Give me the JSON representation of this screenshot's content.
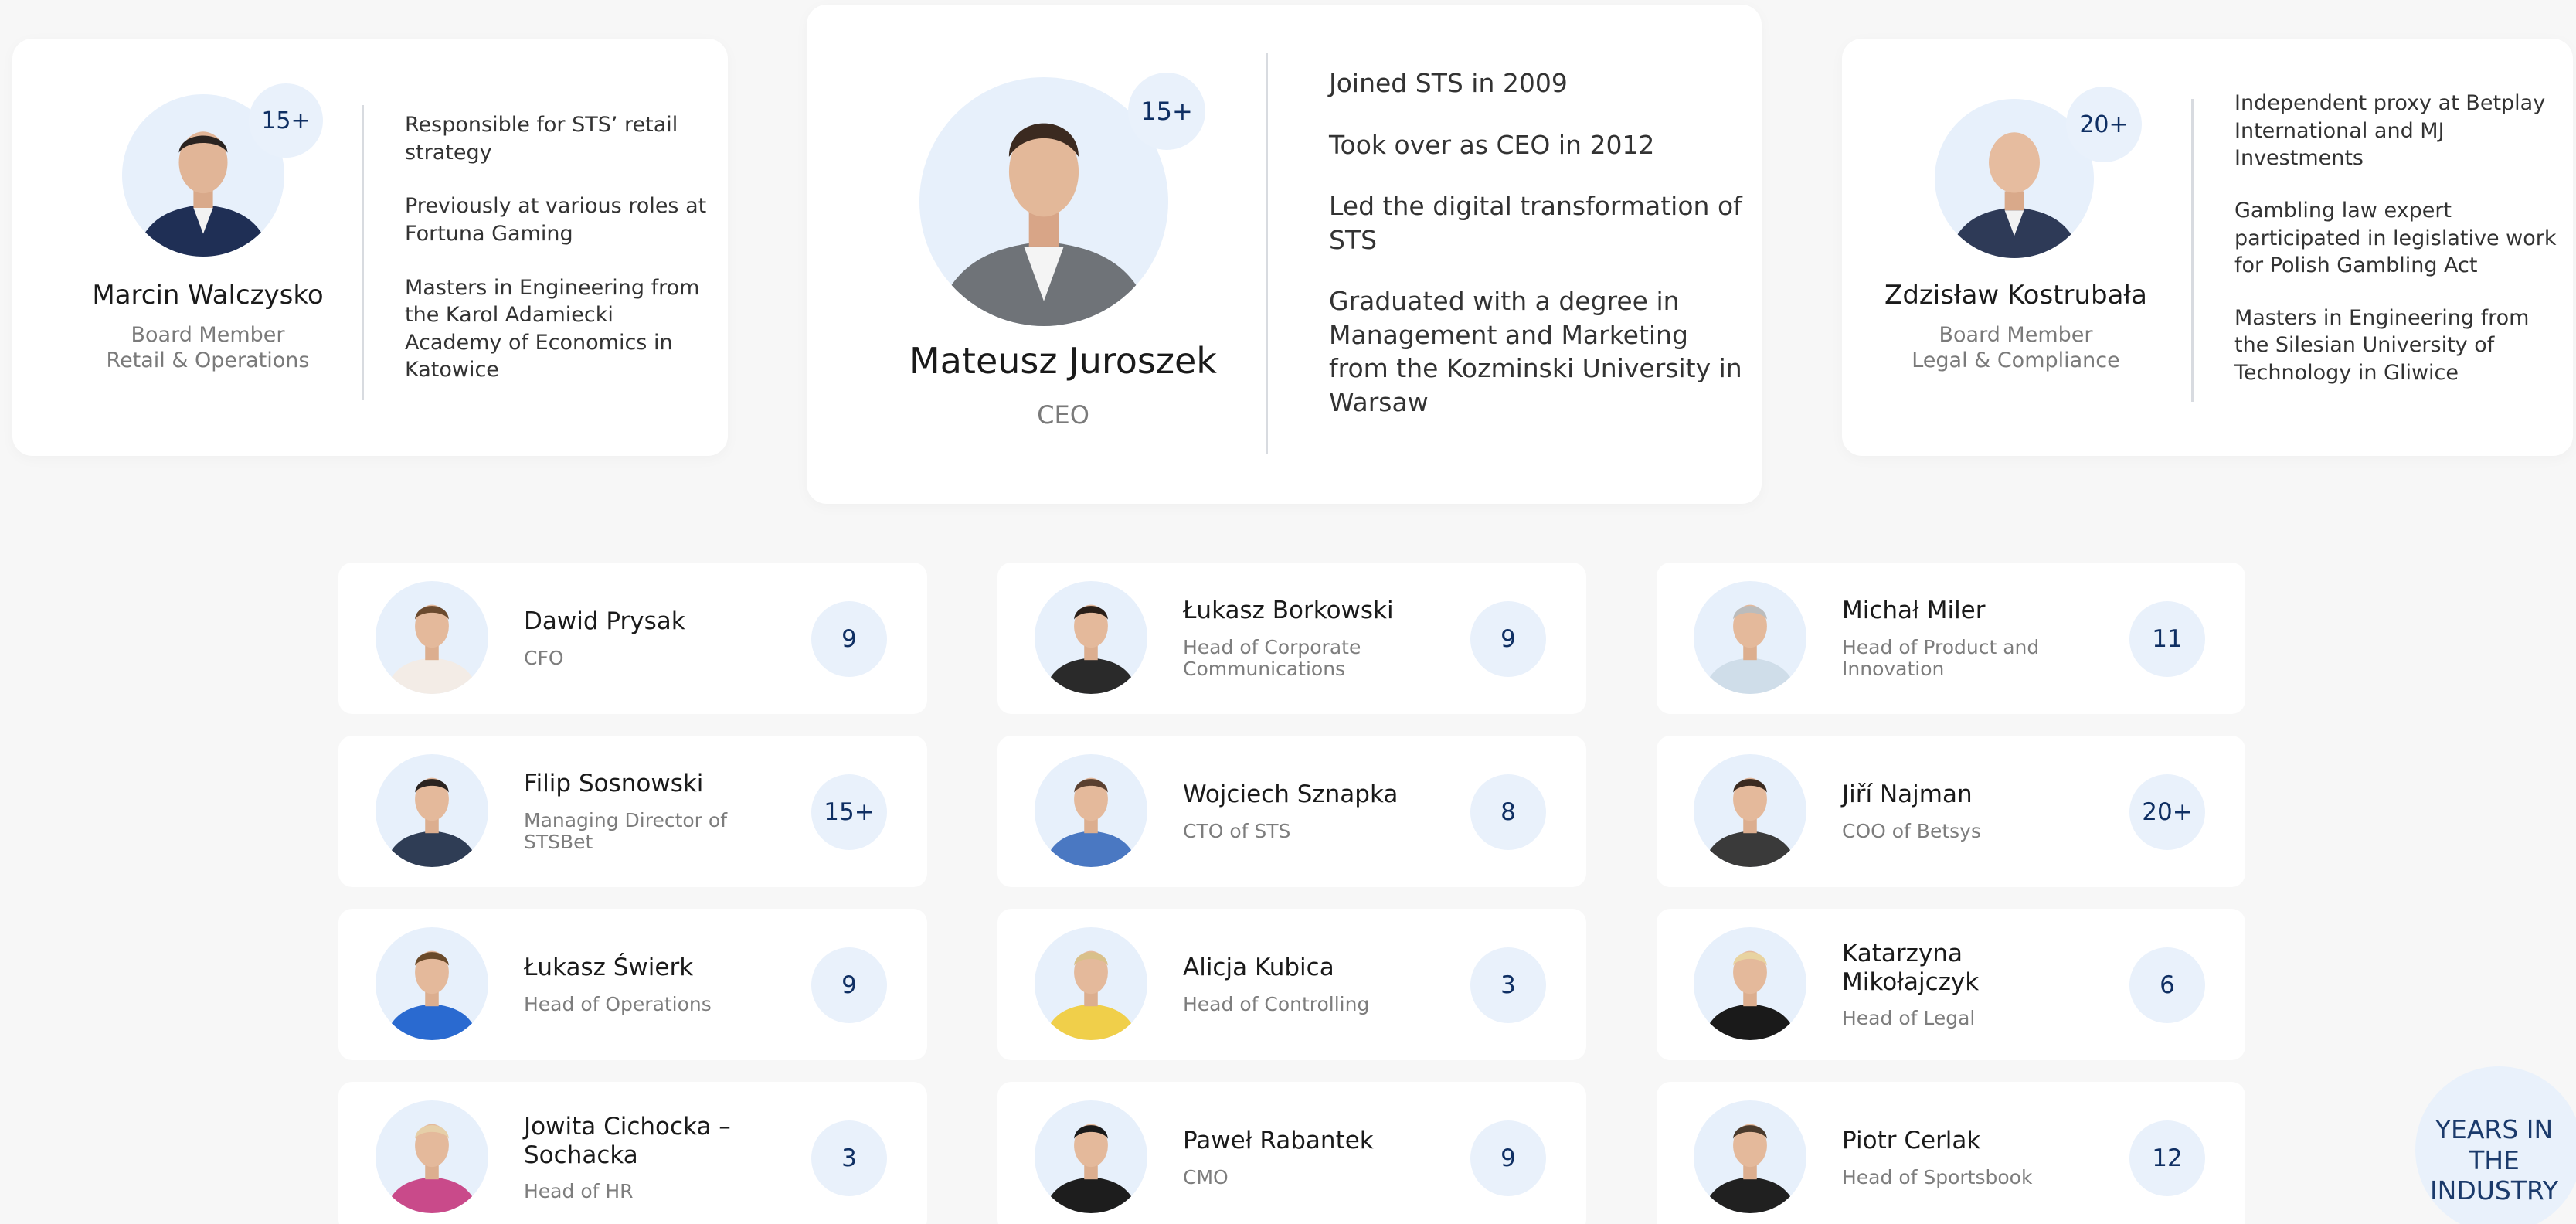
{
  "executives": [
    {
      "name": "Marcin Walczysko",
      "role_line1": "Board Member",
      "role_line2": "Retail & Operations",
      "years": "15+",
      "facts": [
        "Responsible for STS’ retail strategy",
        "Previously at various roles at Fortuna Gaming",
        "Masters in Engineering from the Karol Adamiecki Academy of Economics in Katowice"
      ]
    },
    {
      "name": "Mateusz Juroszek",
      "role_line1": "CEO",
      "role_line2": "",
      "years": "15+",
      "facts": [
        "Joined STS in 2009",
        "Took over as CEO in 2012",
        "Led the digital transformation of STS",
        "Graduated with a degree in Management and Marketing from the Kozminski University in Warsaw"
      ]
    },
    {
      "name": "Zdzisław Kostrubała",
      "role_line1": "Board Member",
      "role_line2": "Legal & Compliance",
      "years": "20+",
      "facts": [
        "Independent proxy at Betplay International and MJ Investments",
        "Gambling law expert participated in legislative work for Polish Gambling Act",
        "Masters in Engineering from the Silesian University of Technology in Gliwice"
      ]
    }
  ],
  "team": [
    {
      "name": "Dawid Prysak",
      "role": "CFO",
      "years": "9"
    },
    {
      "name": "Łukasz Borkowski",
      "role": "Head of Corporate Communications",
      "years": "9"
    },
    {
      "name": "Michał Miler",
      "role": "Head of Product and Innovation",
      "years": "11"
    },
    {
      "name": "Filip Sosnowski",
      "role": "Managing Director of STSBet",
      "years": "15+"
    },
    {
      "name": "Wojciech Sznapka",
      "role": "CTO of STS",
      "years": "8"
    },
    {
      "name": "Jiří Najman",
      "role": "COO of Betsys",
      "years": "20+"
    },
    {
      "name": "Łukasz Świerk",
      "role": "Head of Operations",
      "years": "9"
    },
    {
      "name": "Alicja Kubica",
      "role": "Head of Controlling",
      "years": "3"
    },
    {
      "name": "Katarzyna Mikołajczyk",
      "role": "Head of Legal",
      "years": "6"
    },
    {
      "name": "Jowita Cichocka – Sochacka",
      "role": "Head of HR",
      "years": "3"
    },
    {
      "name": "Paweł Rabantek",
      "role": "CMO",
      "years": "9"
    },
    {
      "name": "Piotr Cerlak",
      "role": "Head of Sportsbook",
      "years": "12"
    }
  ],
  "legend": {
    "label": "YEARS IN\nTHE INDUSTRY"
  },
  "colors": {
    "background": "#f7f7f7",
    "card": "#ffffff",
    "badge_bg": "#e9f1fb",
    "badge_text": "#0f2f63",
    "avatar_bg": "#e7f0fb"
  }
}
